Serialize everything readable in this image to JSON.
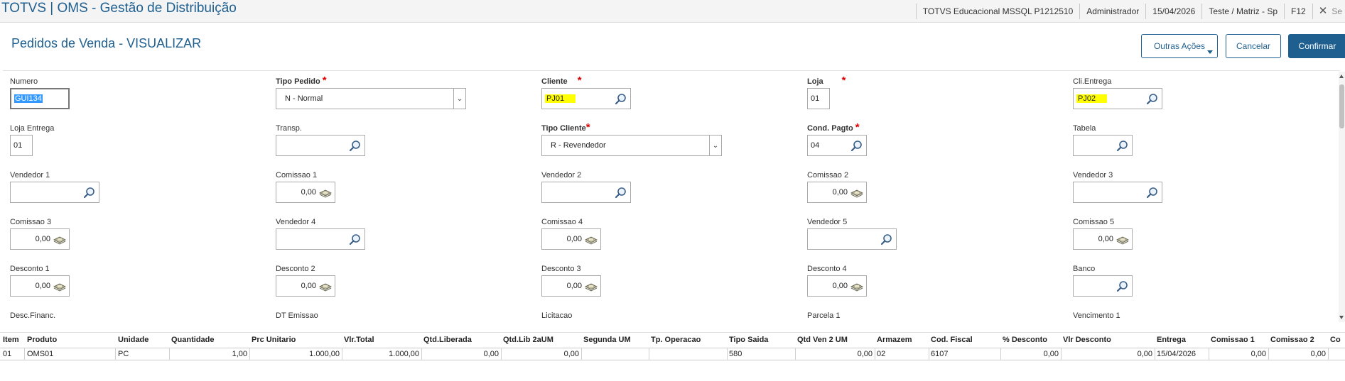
{
  "topbar": {
    "app_title": "TOTVS | OMS - Gestão de Distribuição",
    "environment": "TOTVS Educacional MSSQL P1212510",
    "user": "Administrador",
    "date": "15/04/2026",
    "branch": "Teste / Matriz - Sp",
    "shortcut": "F12",
    "close_label": "Se"
  },
  "header": {
    "title": "Pedidos de Venda - VISUALIZAR",
    "other_actions_label": "Outras Ações",
    "cancel_label": "Cancelar",
    "confirm_label": "Confirmar"
  },
  "form": {
    "numero": {
      "label": "Numero",
      "value": "GUI134"
    },
    "tipo_pedido": {
      "label": "Tipo Pedido",
      "value": "N - Normal"
    },
    "cliente": {
      "label": "Cliente",
      "value": "PJ01"
    },
    "loja": {
      "label": "Loja",
      "value": "01"
    },
    "cli_entrega": {
      "label": "Cli.Entrega",
      "value": "PJ02"
    },
    "loja_entrega": {
      "label": "Loja Entrega",
      "value": "01"
    },
    "transp": {
      "label": "Transp.",
      "value": ""
    },
    "tipo_cliente": {
      "label": "Tipo Cliente",
      "value": "R - Revendedor"
    },
    "cond_pagto": {
      "label": "Cond. Pagto",
      "value": "04"
    },
    "tabela": {
      "label": "Tabela",
      "value": ""
    },
    "vendedor1": {
      "label": "Vendedor 1",
      "value": ""
    },
    "comissao1": {
      "label": "Comissao 1",
      "value": "0,00"
    },
    "vendedor2": {
      "label": "Vendedor 2",
      "value": ""
    },
    "comissao2": {
      "label": "Comissao 2",
      "value": "0,00"
    },
    "vendedor3": {
      "label": "Vendedor 3",
      "value": ""
    },
    "comissao3": {
      "label": "Comissao 3",
      "value": "0,00"
    },
    "vendedor4": {
      "label": "Vendedor 4",
      "value": ""
    },
    "comissao4": {
      "label": "Comissao 4",
      "value": "0,00"
    },
    "vendedor5": {
      "label": "Vendedor 5",
      "value": ""
    },
    "comissao5": {
      "label": "Comissao 5",
      "value": "0,00"
    },
    "desconto1": {
      "label": "Desconto 1",
      "value": "0,00"
    },
    "desconto2": {
      "label": "Desconto 2",
      "value": "0,00"
    },
    "desconto3": {
      "label": "Desconto 3",
      "value": "0,00"
    },
    "desconto4": {
      "label": "Desconto 4",
      "value": "0,00"
    },
    "banco": {
      "label": "Banco",
      "value": ""
    },
    "desc_financ": {
      "label": "Desc.Financ."
    },
    "dt_emissao": {
      "label": "DT Emissao"
    },
    "licitacao": {
      "label": "Licitacao"
    },
    "parcela1": {
      "label": "Parcela 1"
    },
    "vencimento1": {
      "label": "Vencimento 1"
    }
  },
  "grid": {
    "columns": [
      "Item",
      "Produto",
      "Unidade",
      "Quantidade",
      "Prc Unitario",
      "Vlr.Total",
      "Qtd.Liberada",
      "Qtd.Lib 2aUM",
      "Segunda UM",
      "Tp. Operacao",
      "Tipo Saida",
      "Qtd Ven 2 UM",
      "Armazem",
      "Cod. Fiscal",
      "% Desconto",
      "Vlr Desconto",
      "Entrega",
      "Comissao 1",
      "Comissao 2",
      "Co"
    ],
    "rows": [
      {
        "item": "01",
        "produto": "OMS01",
        "unidade": "PC",
        "quantidade": "1,00",
        "prc_unitario": "1.000,00",
        "vlr_total": "1.000,00",
        "qtd_liberada": "0,00",
        "qtd_lib_2aum": "0,00",
        "segunda_um": "",
        "tp_operacao": "",
        "tipo_saida": "580",
        "qtd_ven_2um": "0,00",
        "armazem": "02",
        "cod_fiscal": "6107",
        "pct_desconto": "0,00",
        "vlr_desconto": "0,00",
        "entrega": "15/04/2026",
        "comissao1": "0,00",
        "comissao2": "0,00"
      }
    ]
  },
  "colors": {
    "brand": "#1f5f8f",
    "highlight": "#ffff00",
    "required": "#e00000",
    "selection": "#3399ff"
  }
}
